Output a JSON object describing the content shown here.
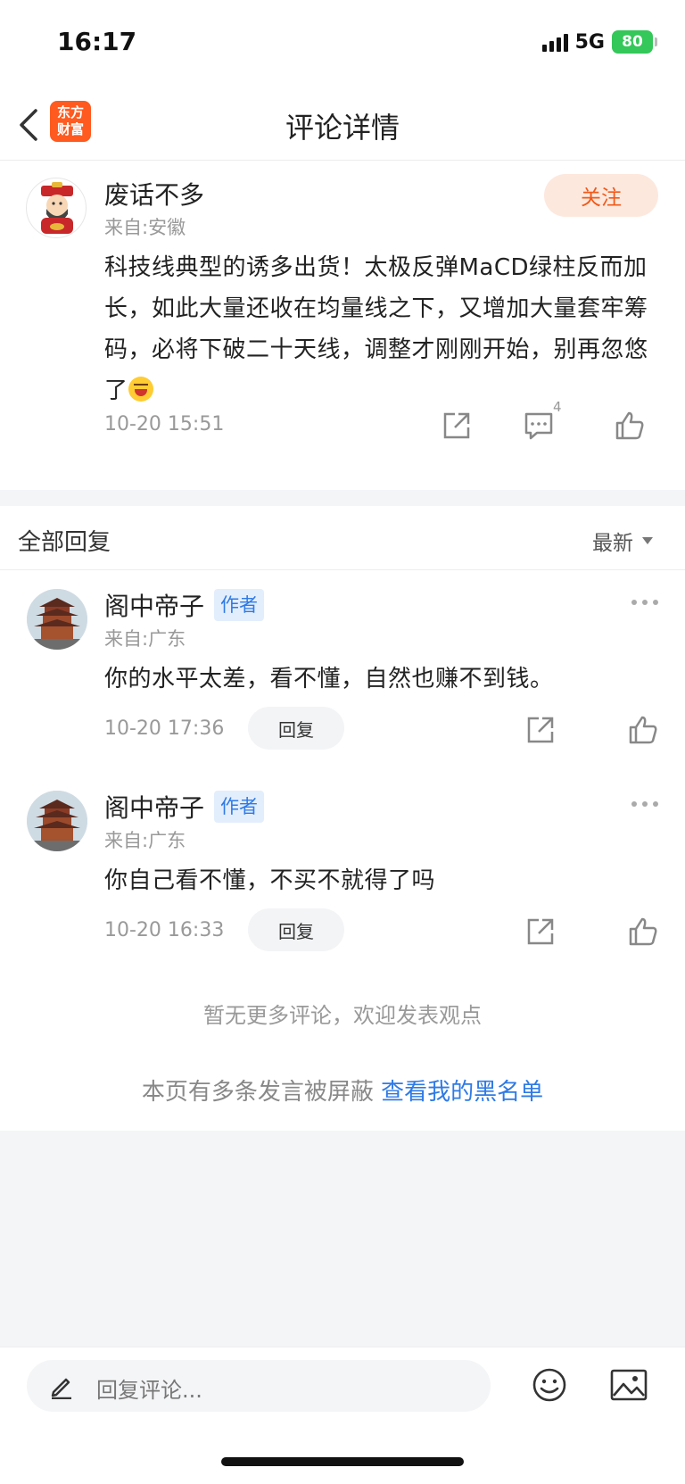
{
  "status": {
    "time": "16:17",
    "network": "5G",
    "battery": "80"
  },
  "nav": {
    "title": "评论详情",
    "logo_text": "东方财富"
  },
  "post": {
    "author": "废话不多",
    "from": "来自:安徽",
    "follow_label": "关注",
    "content": "科技线典型的诱多出货！太极反弹MaCD绿柱反而加长，如此大量还收在均量线之下，又增加大量套牢筹码，必将下破二十天线，调整才刚刚开始，别再忽悠了",
    "time": "10-20 15:51",
    "comment_count": "4"
  },
  "replies_header": {
    "title": "全部回复",
    "sort_label": "最新"
  },
  "replies": [
    {
      "author": "阁中帝子",
      "tag": "作者",
      "from": "来自:广东",
      "text": "你的水平太差，看不懂，自然也赚不到钱。",
      "time": "10-20 17:36",
      "reply_label": "回复"
    },
    {
      "author": "阁中帝子",
      "tag": "作者",
      "from": "来自:广东",
      "text": "你自己看不懂，不买不就得了吗",
      "time": "10-20 16:33",
      "reply_label": "回复"
    }
  ],
  "footer": {
    "no_more": "暂无更多评论，欢迎发表观点",
    "blocked_text": "本页有多条发言被屏蔽 ",
    "blacklist_link": "查看我的黑名单"
  },
  "bottom_bar": {
    "placeholder": "回复评论..."
  },
  "colors": {
    "accent": "#f05a1a",
    "link": "#2f7ae5",
    "tag_bg": "#e3eefc",
    "battery": "#34c759"
  }
}
